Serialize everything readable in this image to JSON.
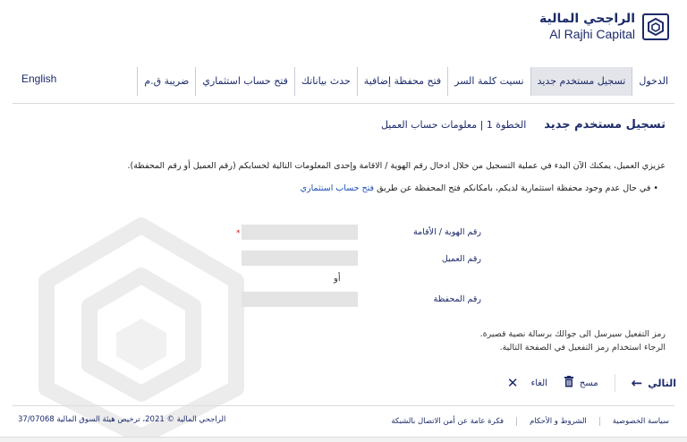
{
  "brand": {
    "name_ar": "الراجحي المالية",
    "name_en": "Al Rajhi Capital"
  },
  "nav": {
    "items": [
      {
        "label": "الدخول"
      },
      {
        "label": "تسجيل مستخدم جديد",
        "active": true
      },
      {
        "label": "نسيت كلمة السر"
      },
      {
        "label": "فتح محفظة إضافية"
      },
      {
        "label": "حدث بياناتك"
      },
      {
        "label": "فتح حساب استثماري"
      },
      {
        "label": "ضريبة ق.م"
      }
    ],
    "language": "English"
  },
  "page": {
    "title": "تسجيل مستخدم جديد",
    "step": "الخطوة 1 | معلومات حساب العميل",
    "intro": "عزيزي العميل، يمكنك الآن البدء في عملية التسجيل من خلال ادخال رقم الهوية / الاقامة وإحدى المعلومات التالية لحسابكم (رقم العميل أو رقم المحفظة).",
    "bullet_text": "في حال عدم وجود محفظة استثمارية لديكم، بامكانكم فتح المحفظة عن طريق ",
    "bullet_link": "فتح حساب استثماري"
  },
  "form": {
    "id_label": "رقم الهوية / الأقامة",
    "id_value": "",
    "required_mark": "*",
    "client_label": "رقم العميل",
    "client_value": "",
    "or": "أو",
    "portfolio_label": "رقم المحفظة",
    "portfolio_value": ""
  },
  "note": {
    "line1": "رمز التفعيل سيرسل الى جوالك برسالة نصية قصيرة.",
    "line2": "الرجاء استخدام رمز التفعيل في الصفحة التالية."
  },
  "actions": {
    "next": "التالي",
    "clear": "مسح",
    "cancel": "الغاء"
  },
  "footer": {
    "links": [
      "سياسة الخصوصية",
      "الشروط و الأحكام",
      "فكرة عامة عن أمن الاتصال بالشبكة"
    ],
    "copyright": "الراجحي المالية © 2021، ترخيص هيئة السوق المالية 37/07068"
  },
  "colors": {
    "primary": "#1c2b6a",
    "link": "#1d4fb4",
    "required": "#d01a1a",
    "input_bg": "#e4e4e4",
    "nav_active_bg": "#e3e5ea"
  }
}
